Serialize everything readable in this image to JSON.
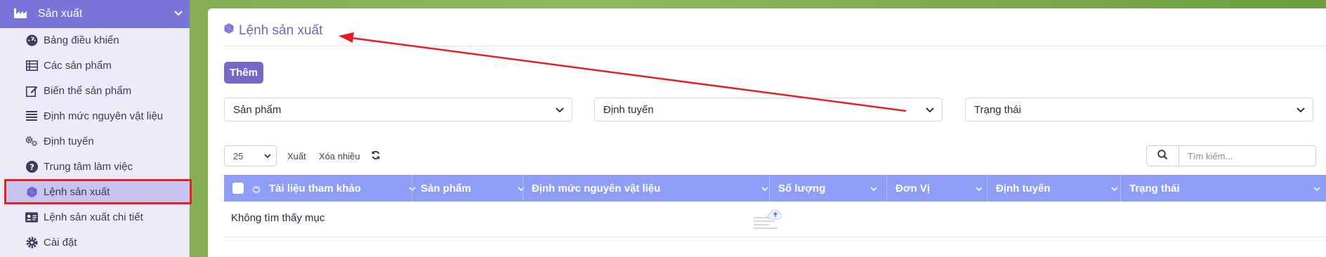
{
  "sidebar": {
    "header": {
      "label": "Sản xuất",
      "icon": "factory-icon"
    },
    "items": [
      {
        "label": "Bảng điều khiển",
        "icon": "dashboard-icon"
      },
      {
        "label": "Các sản phẩm",
        "icon": "list-table-icon"
      },
      {
        "label": "Biến thể sản phẩm",
        "icon": "edit-icon"
      },
      {
        "label": "Định mức nguyên vật liệu",
        "icon": "list-lines-icon"
      },
      {
        "label": "Định tuyến",
        "icon": "gears-icon"
      },
      {
        "label": "Trung tâm làm việc",
        "icon": "question-circle-icon"
      },
      {
        "label": "Lệnh sản xuất",
        "icon": "hexagon-icon",
        "active": true
      },
      {
        "label": "Lệnh sản xuất chi tiết",
        "icon": "id-card-icon"
      },
      {
        "label": "Cài đặt",
        "icon": "gear-icon"
      }
    ]
  },
  "page": {
    "title": "Lệnh sản xuất",
    "add_label": "Thêm",
    "filters": {
      "product": "Sản phẩm",
      "routing": "Định tuyến",
      "status": "Trạng thái"
    },
    "toolbar": {
      "page_size": "25",
      "export_label": "Xuất",
      "bulk_delete_label": "Xóa nhiều",
      "search_placeholder": "Tìm kiếm..."
    },
    "table": {
      "columns": [
        "Tài liệu tham khảo",
        "Sản phẩm",
        "Định mức nguyên vật liệu",
        "Số lượng",
        "Đơn Vị",
        "Định tuyến",
        "Trạng thái"
      ],
      "empty_text": "Không tìm thấy mục"
    }
  },
  "colors": {
    "sidebar_header": "#7b74d8",
    "sidebar_bg": "#ecebf8",
    "active_item": "#c9c4ef",
    "highlight_border": "#e42025",
    "primary_button": "#7469c4",
    "table_header": "#8e9df6",
    "title_text": "#6b67b8"
  }
}
